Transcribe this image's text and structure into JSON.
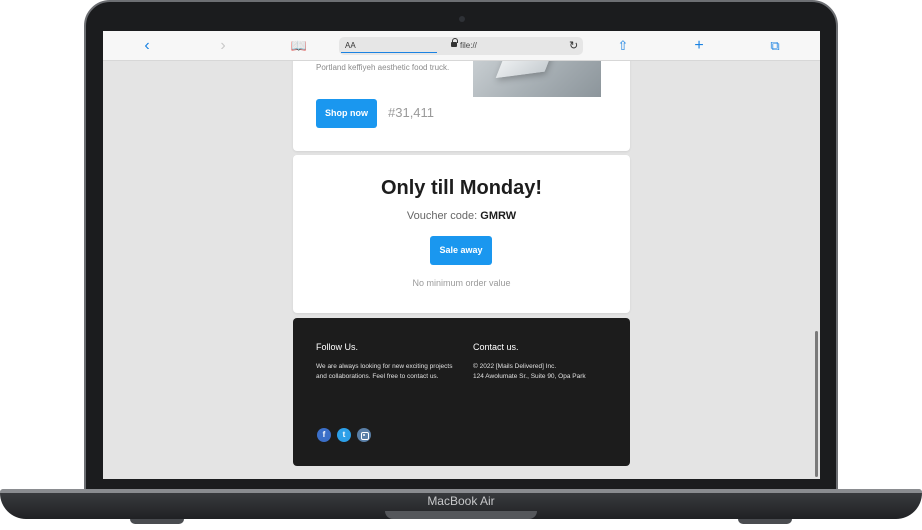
{
  "device": {
    "model_label": "MacBook Air"
  },
  "browser": {
    "addr_aa": "AA",
    "url": "file://",
    "icons": [
      "back-icon",
      "forward-icon",
      "bookmarks-icon",
      "lock-icon",
      "reload-icon",
      "share-icon",
      "new-tab-icon",
      "tabs-icon"
    ]
  },
  "product": {
    "description": "Portland keffiyeh aesthetic food truck.",
    "shop_button": "Shop now",
    "id": "#31,411"
  },
  "voucher": {
    "title": "Only till Monday!",
    "code_label": "Voucher code:",
    "code": "GMRW",
    "button": "Sale away",
    "note": "No minimum order value"
  },
  "footer": {
    "follow": {
      "heading": "Follow Us.",
      "text": "We are always looking for new exciting projects and collaborations. Feel free to contact us."
    },
    "contact": {
      "heading": "Contact us.",
      "copyright": "© 2022 [Mails Delivered] Inc.",
      "address": "124 Awolumate Sr., Suite 90, Opa Park"
    },
    "social": [
      "facebook-icon",
      "twitter-icon",
      "instagram-icon"
    ]
  },
  "colors": {
    "accent": "#1a97ef",
    "footer_bg": "#1c1c1c",
    "page_bg": "#e4e4e4"
  }
}
